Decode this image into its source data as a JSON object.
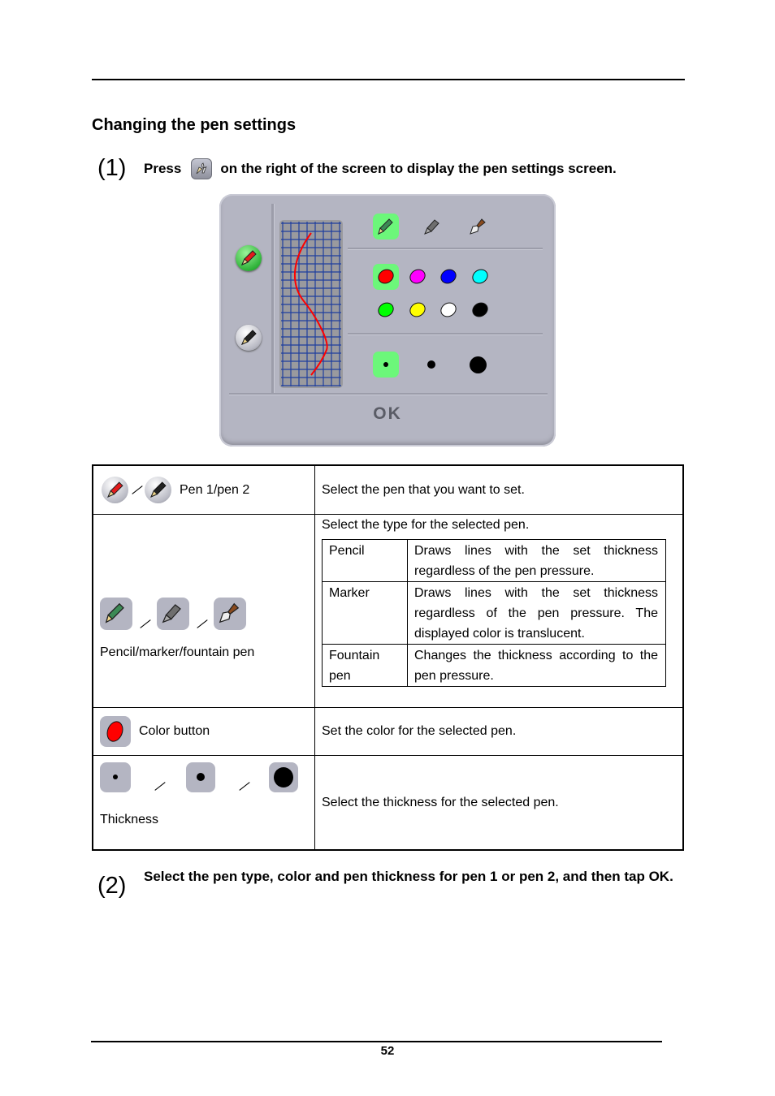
{
  "heading": "Changing the pen settings",
  "step1": {
    "number": "(1)",
    "text_before": "Press",
    "icon": "pen-settings-icon",
    "text_after": "on the right of the screen to display the pen settings screen."
  },
  "panel": {
    "pen_buttons": [
      {
        "name": "pen-1",
        "icon": "red-pencil-icon",
        "selected": true
      },
      {
        "name": "pen-2",
        "icon": "black-pencil-icon",
        "selected": false
      }
    ],
    "pen_types": [
      {
        "name": "pencil",
        "icon": "pencil-icon",
        "selected": true
      },
      {
        "name": "marker",
        "icon": "marker-icon",
        "selected": false
      },
      {
        "name": "fountain-pen",
        "icon": "fountain-pen-icon",
        "selected": false
      }
    ],
    "colors": [
      {
        "name": "red",
        "hex": "#ff0000",
        "selected": true
      },
      {
        "name": "magenta",
        "hex": "#ff00ff",
        "selected": false
      },
      {
        "name": "blue",
        "hex": "#0000ff",
        "selected": false
      },
      {
        "name": "cyan",
        "hex": "#00ffff",
        "selected": false
      },
      {
        "name": "green",
        "hex": "#00ff00",
        "selected": false
      },
      {
        "name": "yellow",
        "hex": "#ffff00",
        "selected": false
      },
      {
        "name": "white",
        "hex": "#ffffff",
        "selected": false
      },
      {
        "name": "black",
        "hex": "#000000",
        "selected": false
      }
    ],
    "thicknesses": [
      {
        "name": "thin",
        "selected": true
      },
      {
        "name": "medium",
        "selected": false
      },
      {
        "name": "thick",
        "selected": false
      }
    ],
    "selected_highlight": "#6cf77a",
    "preview_stroke_color": "#ff0000",
    "ok_label": "OK"
  },
  "table": {
    "rows": [
      {
        "label": "Pen 1/pen 2",
        "icons": [
          "red-pencil-icon",
          "black-pencil-icon"
        ],
        "description": "Select the pen that you want to set."
      },
      {
        "label": "Pencil/marker/fountain pen",
        "icons": [
          "pencil-icon",
          "marker-icon",
          "fountain-pen-icon"
        ],
        "description": "Select the type for the selected pen.",
        "types": [
          {
            "type": "Pencil",
            "description": "Draws lines with the set thickness regardless of the pen pressure."
          },
          {
            "type": "Marker",
            "description": "Draws lines with the set thickness regardless of the pen pressure. The displayed color is translucent."
          },
          {
            "type": "Fountain pen",
            "description": "Changes the thickness according to the pen pressure."
          }
        ]
      },
      {
        "label": "Color button",
        "icons": [
          "red-color-swatch-icon"
        ],
        "description": "Set the color for the selected pen."
      },
      {
        "label": "Thickness",
        "icons": [
          "thin-dot-icon",
          "medium-dot-icon",
          "thick-dot-icon"
        ],
        "description": "Select the thickness for the selected pen."
      }
    ]
  },
  "step2": {
    "number": "(2)",
    "text": "Select the pen type, color and pen thickness for pen 1 or pen 2, and then tap OK."
  },
  "footer": {
    "page_number": "52"
  }
}
